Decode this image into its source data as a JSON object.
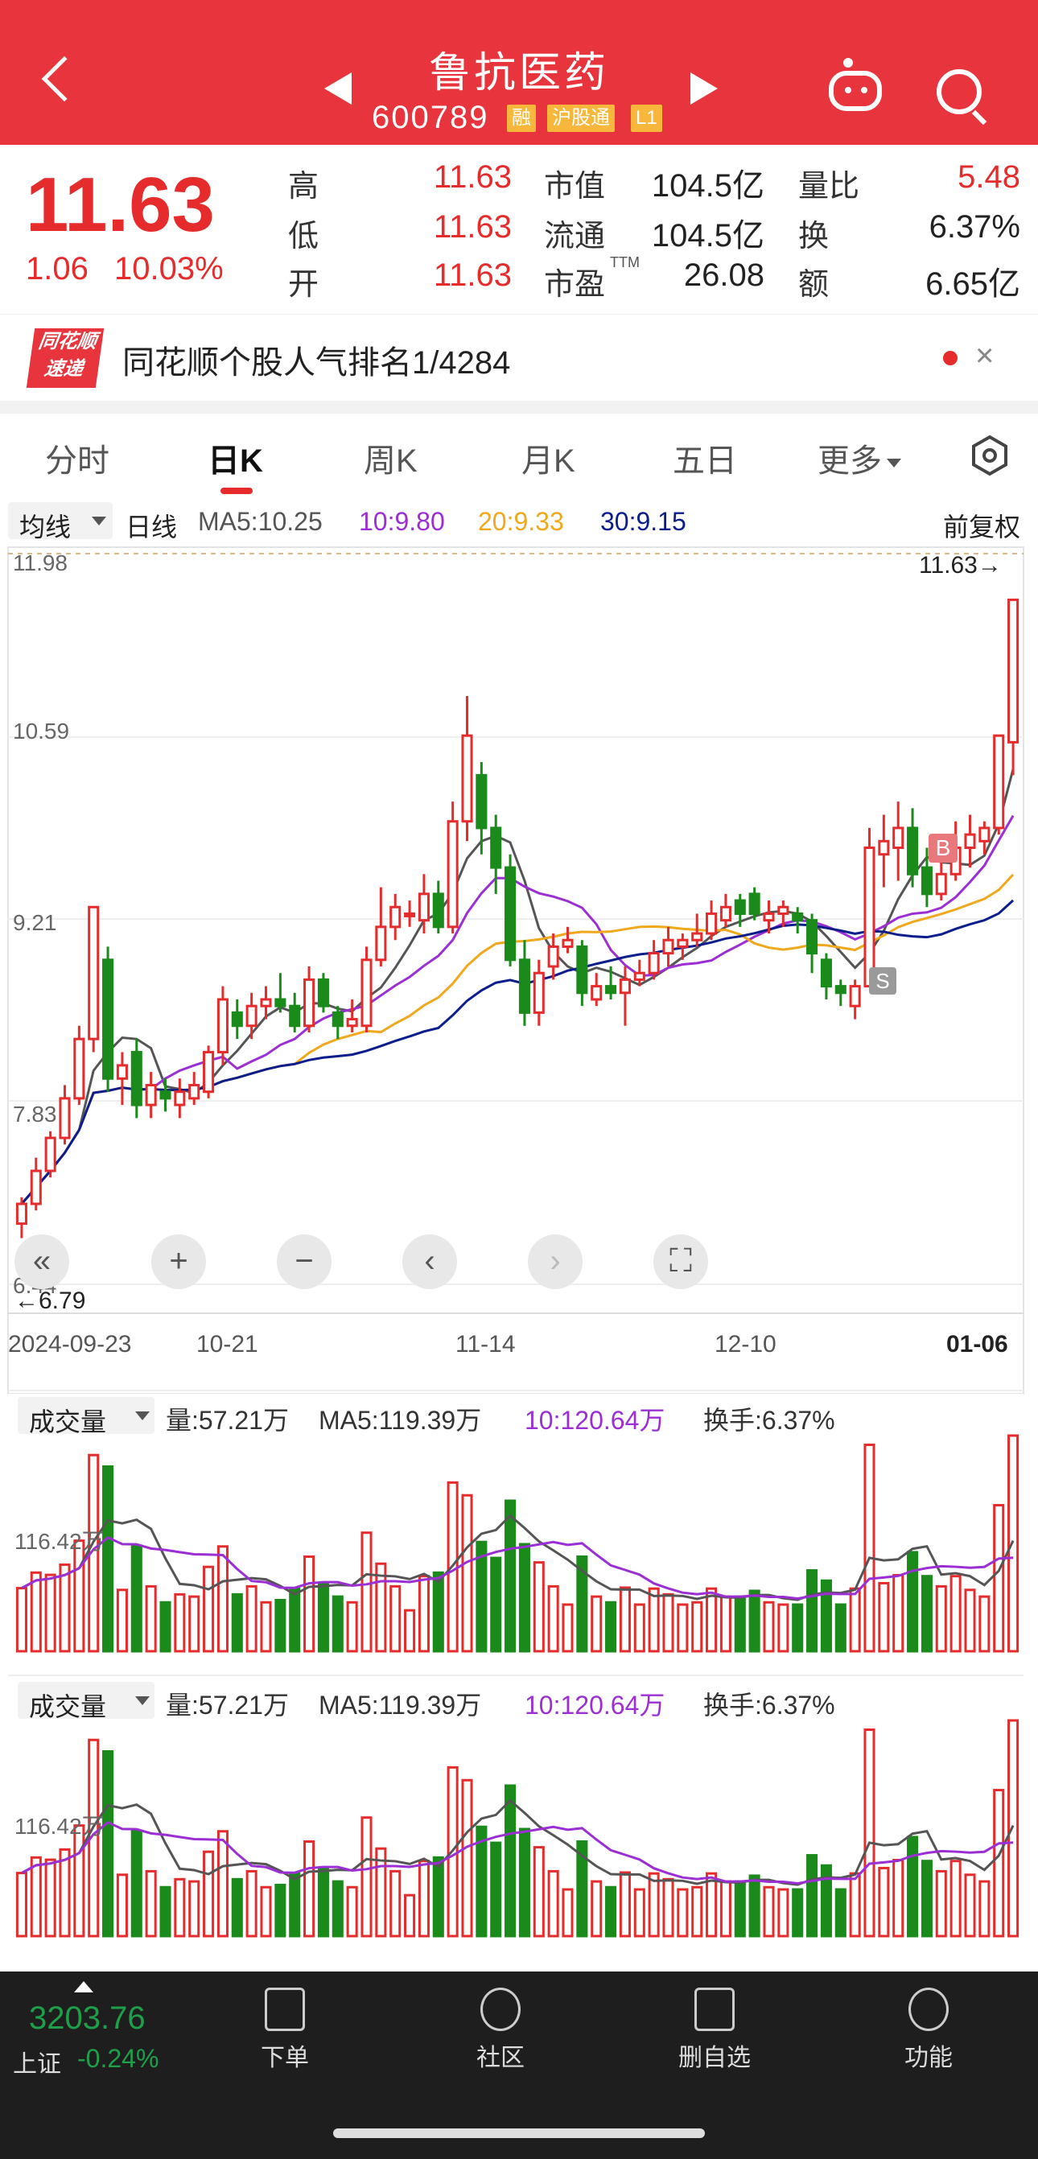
{
  "header": {
    "title": "鲁抗医药",
    "code": "600789",
    "tags": [
      "融",
      "沪股通",
      "L1"
    ]
  },
  "quote": {
    "price": "11.63",
    "change": "1.06",
    "change_pct": "10.03%",
    "rows": [
      {
        "l1": "高",
        "v1": "11.63",
        "l2": "市值",
        "v2": "104.5亿",
        "l3": "量比",
        "v3": "5.48"
      },
      {
        "l1": "低",
        "v1": "11.63",
        "l2": "流通",
        "v2": "104.5亿",
        "l3": "换",
        "v3": "6.37%"
      },
      {
        "l1": "开",
        "v1": "11.63",
        "l2": "市盈",
        "v2": "26.08",
        "l3": "额",
        "v3": "6.65亿"
      }
    ],
    "ttm": "TTM"
  },
  "banner": {
    "logo_line1": "同花顺",
    "logo_line2": "速递",
    "text": "同花顺个股人气排名1/4284",
    "close": "×"
  },
  "tabs": [
    "分时",
    "日K",
    "周K",
    "月K",
    "五日",
    "更多"
  ],
  "indicator_row": {
    "selector": "均线",
    "period": "日线",
    "ma5": "MA5:10.25",
    "ma10": "10:9.80",
    "ma20": "20:9.33",
    "ma30": "30:9.15",
    "adjust": "前复权"
  },
  "colors": {
    "up": "#e52b2b",
    "down": "#1a8a1a",
    "ma5": "#555555",
    "ma10": "#9b2fd4",
    "ma20": "#f0a81c",
    "ma30": "#0c1d8c"
  },
  "chart_data": {
    "type": "candlestick",
    "y_ticks": [
      "11.98",
      "10.59",
      "9.21",
      "7.83",
      "6.44"
    ],
    "ylim": [
      6.44,
      11.98
    ],
    "high_marker": "11.63→",
    "low_marker": "←6.79",
    "x_ticks": [
      "2024-09-23",
      "10-21",
      "11-14",
      "12-10",
      "01-06"
    ],
    "markers": [
      "B",
      "S"
    ],
    "candles": [
      {
        "o": 6.9,
        "c": 7.05,
        "h": 7.1,
        "l": 6.79
      },
      {
        "o": 7.05,
        "c": 7.3,
        "h": 7.4,
        "l": 7.0
      },
      {
        "o": 7.3,
        "c": 7.55,
        "h": 7.6,
        "l": 7.25
      },
      {
        "o": 7.55,
        "c": 7.85,
        "h": 7.95,
        "l": 7.5
      },
      {
        "o": 7.85,
        "c": 8.3,
        "h": 8.4,
        "l": 7.8
      },
      {
        "o": 8.3,
        "c": 9.3,
        "h": 9.3,
        "l": 8.2
      },
      {
        "o": 8.9,
        "c": 8.0,
        "h": 9.0,
        "l": 7.9
      },
      {
        "o": 8.0,
        "c": 8.1,
        "h": 8.2,
        "l": 7.8
      },
      {
        "o": 8.2,
        "c": 7.8,
        "h": 8.3,
        "l": 7.7
      },
      {
        "o": 7.8,
        "c": 7.95,
        "h": 8.05,
        "l": 7.7
      },
      {
        "o": 7.9,
        "c": 7.85,
        "h": 8.0,
        "l": 7.75
      },
      {
        "o": 7.8,
        "c": 7.9,
        "h": 8.0,
        "l": 7.7
      },
      {
        "o": 7.85,
        "c": 7.95,
        "h": 8.05,
        "l": 7.8
      },
      {
        "o": 7.9,
        "c": 8.2,
        "h": 8.25,
        "l": 7.85
      },
      {
        "o": 8.2,
        "c": 8.6,
        "h": 8.7,
        "l": 8.1
      },
      {
        "o": 8.5,
        "c": 8.4,
        "h": 8.6,
        "l": 8.3
      },
      {
        "o": 8.4,
        "c": 8.55,
        "h": 8.65,
        "l": 8.3
      },
      {
        "o": 8.55,
        "c": 8.6,
        "h": 8.7,
        "l": 8.45
      },
      {
        "o": 8.6,
        "c": 8.55,
        "h": 8.8,
        "l": 8.5
      },
      {
        "o": 8.55,
        "c": 8.4,
        "h": 8.65,
        "l": 8.35
      },
      {
        "o": 8.4,
        "c": 8.75,
        "h": 8.85,
        "l": 8.35
      },
      {
        "o": 8.75,
        "c": 8.55,
        "h": 8.8,
        "l": 8.5
      },
      {
        "o": 8.5,
        "c": 8.4,
        "h": 8.55,
        "l": 8.3
      },
      {
        "o": 8.4,
        "c": 8.45,
        "h": 8.6,
        "l": 8.35
      },
      {
        "o": 8.4,
        "c": 8.9,
        "h": 9.0,
        "l": 8.35
      },
      {
        "o": 8.9,
        "c": 9.15,
        "h": 9.45,
        "l": 8.85
      },
      {
        "o": 9.15,
        "c": 9.3,
        "h": 9.4,
        "l": 9.05
      },
      {
        "o": 9.25,
        "c": 9.25,
        "h": 9.35,
        "l": 9.15
      },
      {
        "o": 9.2,
        "c": 9.4,
        "h": 9.55,
        "l": 9.1
      },
      {
        "o": 9.4,
        "c": 9.15,
        "h": 9.5,
        "l": 9.1
      },
      {
        "o": 9.15,
        "c": 9.95,
        "h": 10.1,
        "l": 9.1
      },
      {
        "o": 9.95,
        "c": 10.6,
        "h": 10.9,
        "l": 9.8
      },
      {
        "o": 10.3,
        "c": 9.9,
        "h": 10.4,
        "l": 9.7
      },
      {
        "o": 9.9,
        "c": 9.6,
        "h": 10.0,
        "l": 9.4
      },
      {
        "o": 9.6,
        "c": 8.9,
        "h": 9.7,
        "l": 8.85
      },
      {
        "o": 8.9,
        "c": 8.5,
        "h": 9.05,
        "l": 8.4
      },
      {
        "o": 8.5,
        "c": 8.8,
        "h": 8.9,
        "l": 8.4
      },
      {
        "o": 8.85,
        "c": 9.0,
        "h": 9.1,
        "l": 8.75
      },
      {
        "o": 9.0,
        "c": 9.05,
        "h": 9.15,
        "l": 8.95
      },
      {
        "o": 9.0,
        "c": 8.65,
        "h": 9.05,
        "l": 8.55
      },
      {
        "o": 8.6,
        "c": 8.7,
        "h": 8.8,
        "l": 8.55
      },
      {
        "o": 8.7,
        "c": 8.65,
        "h": 8.85,
        "l": 8.6
      },
      {
        "o": 8.65,
        "c": 8.75,
        "h": 8.85,
        "l": 8.4
      },
      {
        "o": 8.75,
        "c": 8.8,
        "h": 8.9,
        "l": 8.7
      },
      {
        "o": 8.8,
        "c": 8.95,
        "h": 9.05,
        "l": 8.75
      },
      {
        "o": 8.95,
        "c": 9.05,
        "h": 9.15,
        "l": 8.85
      },
      {
        "o": 9.0,
        "c": 9.05,
        "h": 9.1,
        "l": 8.9
      },
      {
        "o": 9.05,
        "c": 9.1,
        "h": 9.25,
        "l": 9.0
      },
      {
        "o": 9.1,
        "c": 9.25,
        "h": 9.35,
        "l": 9.05
      },
      {
        "o": 9.2,
        "c": 9.3,
        "h": 9.4,
        "l": 9.15
      },
      {
        "o": 9.35,
        "c": 9.25,
        "h": 9.4,
        "l": 9.15
      },
      {
        "o": 9.4,
        "c": 9.25,
        "h": 9.45,
        "l": 9.2
      },
      {
        "o": 9.2,
        "c": 9.25,
        "h": 9.35,
        "l": 9.1
      },
      {
        "o": 9.25,
        "c": 9.3,
        "h": 9.35,
        "l": 9.15
      },
      {
        "o": 9.25,
        "c": 9.2,
        "h": 9.3,
        "l": 9.1
      },
      {
        "o": 9.2,
        "c": 8.95,
        "h": 9.25,
        "l": 8.8
      },
      {
        "o": 8.9,
        "c": 8.7,
        "h": 8.95,
        "l": 8.6
      },
      {
        "o": 8.7,
        "c": 8.65,
        "h": 8.75,
        "l": 8.55
      },
      {
        "o": 8.55,
        "c": 8.7,
        "h": 8.75,
        "l": 8.45
      },
      {
        "o": 8.7,
        "c": 9.75,
        "h": 9.9,
        "l": 8.7
      },
      {
        "o": 9.7,
        "c": 9.8,
        "h": 10.0,
        "l": 9.45
      },
      {
        "o": 9.75,
        "c": 9.9,
        "h": 10.1,
        "l": 9.5
      },
      {
        "o": 9.9,
        "c": 9.55,
        "h": 10.05,
        "l": 9.45
      },
      {
        "o": 9.6,
        "c": 9.4,
        "h": 9.75,
        "l": 9.3
      },
      {
        "o": 9.4,
        "c": 9.55,
        "h": 9.7,
        "l": 9.35
      },
      {
        "o": 9.55,
        "c": 9.75,
        "h": 9.95,
        "l": 9.5
      },
      {
        "o": 9.75,
        "c": 9.85,
        "h": 10.0,
        "l": 9.6
      },
      {
        "o": 9.8,
        "c": 9.9,
        "h": 9.95,
        "l": 9.7
      },
      {
        "o": 9.9,
        "c": 10.6,
        "h": 10.6,
        "l": 9.85
      },
      {
        "o": 10.55,
        "c": 11.63,
        "h": 11.63,
        "l": 10.3
      }
    ]
  },
  "volume_panels": [
    {
      "selector": "成交量",
      "vol": "量:57.21万",
      "ma5": "MA5:119.39万",
      "ma10": "10:120.64万",
      "turnover": "换手:6.37%",
      "tick": "116.42万"
    },
    {
      "selector": "成交量",
      "vol": "量:57.21万",
      "ma5": "MA5:119.39万",
      "ma10": "10:120.64万",
      "turnover": "换手:6.37%",
      "tick": "116.42万"
    }
  ],
  "bottom_bar": {
    "index_value": "3203.76",
    "index_name": "上证",
    "index_change": "-0.24%",
    "items": [
      {
        "label": "下单",
        "icon": "order-icon"
      },
      {
        "label": "社区",
        "icon": "community-icon"
      },
      {
        "label": "删自选",
        "icon": "remove-favorite-icon"
      },
      {
        "label": "功能",
        "icon": "menu-icon"
      }
    ]
  }
}
